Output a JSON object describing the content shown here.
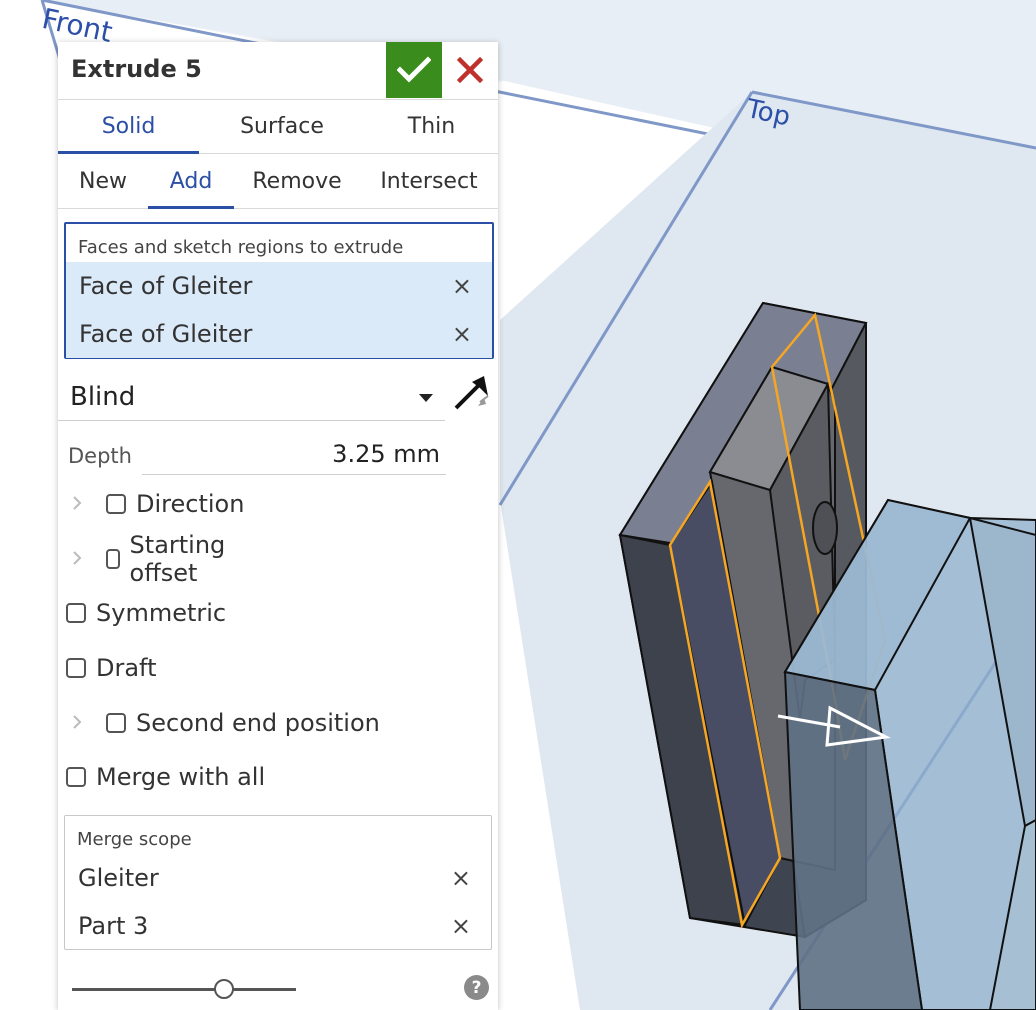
{
  "viewport": {
    "plane_front_label": "Front",
    "plane_top_label": "Top",
    "colors": {
      "plane_fill": "#d7e3ee",
      "plane_edge": "#7f98c8",
      "part_dark": "#3f4550",
      "part_mid": "#5f6166",
      "part_light": "#8a8c92",
      "selection_highlight": "#f5a623",
      "transparent_part": "#8fb0cc"
    }
  },
  "panel": {
    "title": "Extrude 5",
    "confirm_icon": "checkmark-icon",
    "cancel_icon": "close-icon",
    "colors": {
      "accent": "#2b4fa6",
      "confirm": "#3a8d1c",
      "cancel": "#c0312b",
      "selection_bg": "#dbeaf8"
    },
    "body_tabs": [
      {
        "label": "Solid",
        "active": true
      },
      {
        "label": "Surface",
        "active": false
      },
      {
        "label": "Thin",
        "active": false
      }
    ],
    "op_tabs": [
      {
        "label": "New",
        "active": false
      },
      {
        "label": "Add",
        "active": true
      },
      {
        "label": "Remove",
        "active": false
      },
      {
        "label": "Intersect",
        "active": false
      }
    ],
    "faces": {
      "caption": "Faces and sketch regions to extrude",
      "items": [
        {
          "label": "Face of Gleiter",
          "remove_icon": "×"
        },
        {
          "label": "Face of Gleiter",
          "remove_icon": "×"
        }
      ]
    },
    "end_type": {
      "value": "Blind"
    },
    "flip_icon": "flip-direction-arrow-icon",
    "depth": {
      "label": "Depth",
      "value": "3.25 mm"
    },
    "options": {
      "direction": "Direction",
      "starting_offset": "Starting offset",
      "symmetric": "Symmetric",
      "draft": "Draft",
      "second_end": "Second end position",
      "merge_all": "Merge with all"
    },
    "merge_scope": {
      "caption": "Merge scope",
      "items": [
        {
          "label": "Gleiter",
          "remove_icon": "×"
        },
        {
          "label": "Part 3",
          "remove_icon": "×"
        }
      ]
    },
    "slider": {
      "value": 0.68
    },
    "help_label": "?"
  }
}
